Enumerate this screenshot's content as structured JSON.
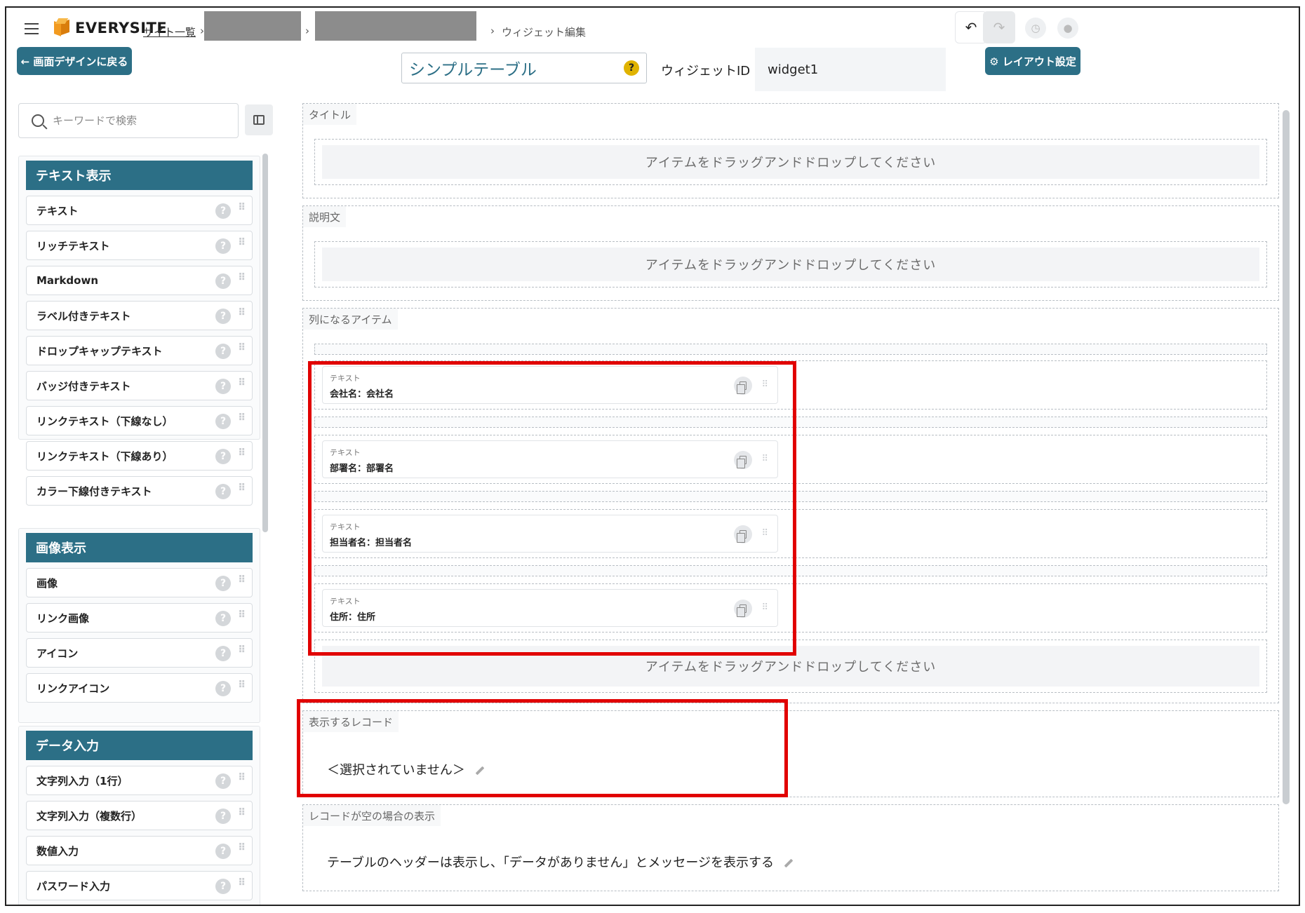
{
  "header": {
    "logo_text": "EVERYSITE",
    "breadcrumb": {
      "site_list": "サイト一覧",
      "sep1": "›",
      "sep2": "›",
      "sep3": "›",
      "current": "ウィジェット編集"
    },
    "undo_icon": "↶",
    "redo_icon": "↷"
  },
  "toolbar": {
    "back_label": "← 画面デザインに戻る",
    "widget_name": "シンプルテーブル",
    "help_mark": "?",
    "widget_id_label": "ウィジェットID",
    "widget_id_value": "widget1",
    "layout_settings_label": "⚙ レイアウト設定"
  },
  "sidebar": {
    "search_placeholder": "キーワードで検索",
    "groups": [
      {
        "title": "テキスト表示",
        "items": [
          "テキスト",
          "リッチテキスト",
          "Markdown",
          "ラベル付きテキスト",
          "ドロップキャップテキスト",
          "バッジ付きテキスト",
          "リンクテキスト（下線なし）",
          "リンクテキスト（下線あり）",
          "カラー下線付きテキスト"
        ]
      },
      {
        "title": "画像表示",
        "items": [
          "画像",
          "リンク画像",
          "アイコン",
          "リンクアイコン"
        ]
      },
      {
        "title": "データ入力",
        "items": [
          "文字列入力（1行）",
          "文字列入力（複数行）",
          "数値入力",
          "パスワード入力"
        ]
      }
    ],
    "help_mark": "?",
    "grip": "⠿"
  },
  "canvas": {
    "title_section": {
      "label": "タイトル",
      "drop": "アイテムをドラッグアンドドロップしてください"
    },
    "desc_section": {
      "label": "説明文",
      "drop": "アイテムをドラッグアンドドロップしてください"
    },
    "columns_section": {
      "label": "列になるアイテム",
      "cards": [
        {
          "caption": "テキスト",
          "value": "会社名：会社名"
        },
        {
          "caption": "テキスト",
          "value": "部署名：部署名"
        },
        {
          "caption": "テキスト",
          "value": "担当者名：担当者名"
        },
        {
          "caption": "テキスト",
          "value": "住所：住所"
        }
      ],
      "drop": "アイテムをドラッグアンドドロップしてください"
    },
    "records_section": {
      "label": "表示するレコード",
      "value": "＜選択されていません＞"
    },
    "empty_section": {
      "label": "レコードが空の場合の表示",
      "value": "テーブルのヘッダーは表示し、「データがありません」とメッセージを表示する"
    }
  },
  "colors": {
    "accent": "#2c6f86",
    "highlight": "#e10000",
    "help": "#e0b300",
    "logo": "#f29a1f"
  }
}
